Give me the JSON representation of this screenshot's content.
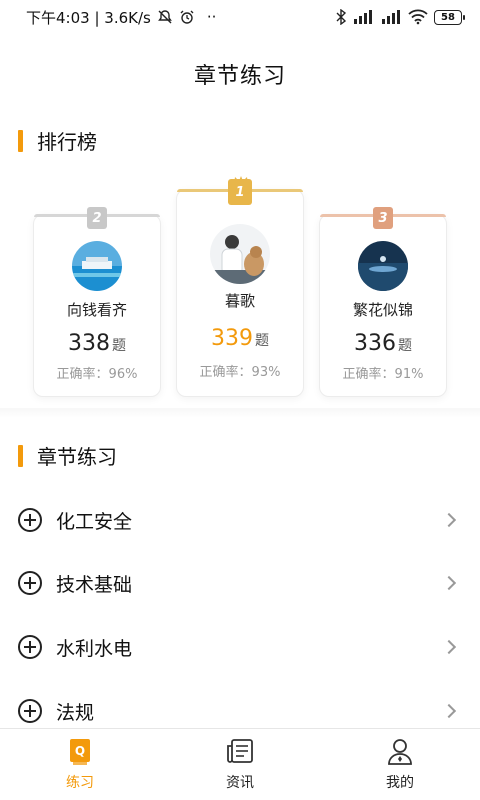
{
  "status_bar": {
    "time_text": "下午4:03 | 3.6K/s",
    "more_dots": "··",
    "battery": "58"
  },
  "page": {
    "title": "章节练习"
  },
  "leaderboard": {
    "section_title": "排行榜",
    "entries": [
      {
        "rank": "2",
        "name": "向钱看齐",
        "count": "338",
        "unit": "题",
        "accuracy": "正确率：96%",
        "badge_color": "#c8c8c8"
      },
      {
        "rank": "1",
        "name": "暮歌",
        "count": "339",
        "unit": "题",
        "accuracy": "正确率：93%",
        "badge_color": "#e8b64a",
        "count_color": "#f39a0c"
      },
      {
        "rank": "3",
        "name": "繁花似锦",
        "count": "336",
        "unit": "题",
        "accuracy": "正确率：91%",
        "badge_color": "#e0a07e"
      }
    ]
  },
  "chapters": {
    "section_title": "章节练习",
    "items": [
      {
        "label": "化工安全"
      },
      {
        "label": "技术基础"
      },
      {
        "label": "水利水电"
      },
      {
        "label": "法规"
      }
    ]
  },
  "tabs": [
    {
      "label": "练习",
      "icon": "practice-icon",
      "active": true
    },
    {
      "label": "资讯",
      "icon": "news-icon",
      "active": false
    },
    {
      "label": "我的",
      "icon": "profile-icon",
      "active": false
    }
  ],
  "colors": {
    "accent": "#f39a0c"
  }
}
